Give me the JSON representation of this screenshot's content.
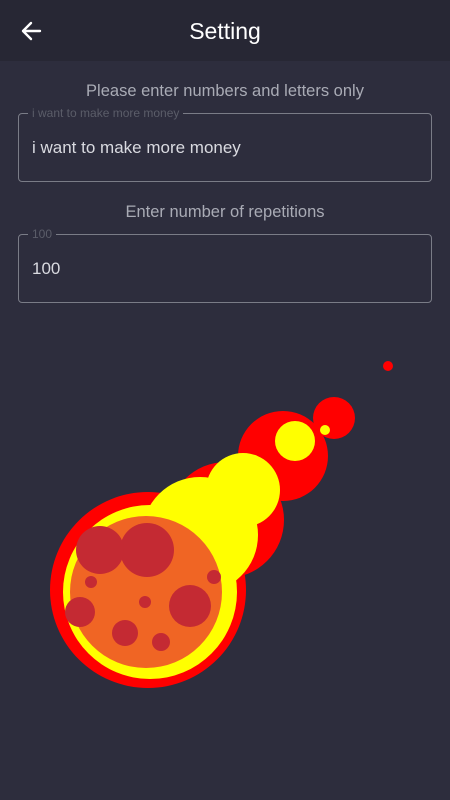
{
  "header": {
    "title": "Setting",
    "back_icon": "arrow-left-icon"
  },
  "text_input": {
    "hint": "Please enter numbers and letters only",
    "label": "i want to make more money",
    "value": "i want to make more money"
  },
  "repetitions_input": {
    "hint": "Enter number of repetitions",
    "label": "100",
    "value": "100"
  },
  "illustration": {
    "name": "meteor-illustration",
    "colors": {
      "red": "#ff0000",
      "yellow": "#ffff00",
      "orange": "#f06524",
      "crater": "#c42a33"
    }
  },
  "colors": {
    "background": "#2d2d3d",
    "topbar": "#272734",
    "hint_text": "#a9abb5",
    "field_border": "#7a7c87"
  }
}
